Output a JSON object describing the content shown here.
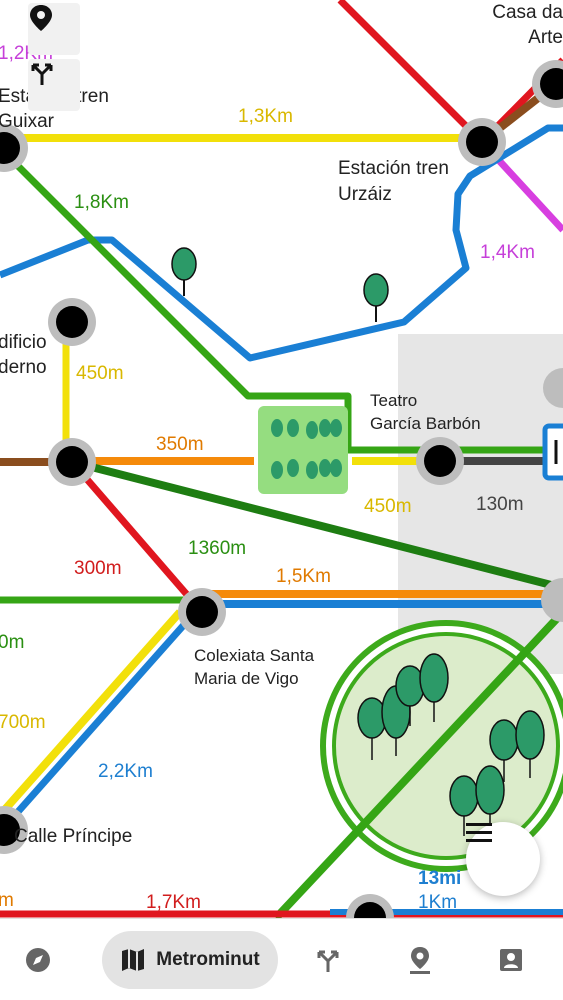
{
  "map": {
    "stations": [
      {
        "name_line1": "Casa da",
        "name_line2": "Arte"
      },
      {
        "name_line1": "Estación tren",
        "name_line2": "Guixar"
      },
      {
        "name_line1": "Estación tren",
        "name_line2": "Urzáiz"
      },
      {
        "name_line1": "dificio",
        "name_line2": "derno"
      },
      {
        "name_line1": "Teatro",
        "name_line2": "García Barbón"
      },
      {
        "name_line1": "Colexiata Santa",
        "name_line2": "Maria de Vigo"
      },
      {
        "name_line1": "Calle Príncipe",
        "name_line2": ""
      }
    ],
    "distances": [
      {
        "text": "1,2Km",
        "color": "#c63fd9"
      },
      {
        "text": "1,3Km",
        "color": "#d9b800"
      },
      {
        "text": "1,8Km",
        "color": "#2a8f12"
      },
      {
        "text": "1,4Km",
        "color": "#c63fd9"
      },
      {
        "text": "450m",
        "color": "#d9b800"
      },
      {
        "text": "350m",
        "color": "#e07a00"
      },
      {
        "text": "450m",
        "color": "#d9b800"
      },
      {
        "text": "130m",
        "color": "#444444"
      },
      {
        "text": "1360m",
        "color": "#2a8f12"
      },
      {
        "text": "300m",
        "color": "#d11d1d"
      },
      {
        "text": "1,5Km",
        "color": "#e07a00"
      },
      {
        "text": "0m",
        "color": "#2a8f12"
      },
      {
        "text": "700m",
        "color": "#d9b800"
      },
      {
        "text": "2,2Km",
        "color": "#1e7fd0"
      },
      {
        "text": "m",
        "color": "#e07a00"
      },
      {
        "text": "1,7Km",
        "color": "#d11d1d"
      },
      {
        "text": "13mi",
        "color": "#1e7fd0"
      },
      {
        "text": "1Km",
        "color": "#1e7fd0"
      }
    ],
    "line_colors": {
      "red": "#e0161f",
      "yellow": "#f2e00a",
      "green": "#35a515",
      "dark_green": "#1e7d12",
      "blue": "#1a7fd4",
      "orange": "#f58a0a",
      "brown": "#8a4d1e",
      "magenta": "#d73fe0",
      "dark_gray": "#444444"
    }
  },
  "controls": {
    "location_icon": "map-pin-icon",
    "routes_icon": "fork-arrows-icon",
    "menu_icon": "hamburger-menu-icon"
  },
  "bottom_nav": {
    "items": [
      {
        "icon": "compass-icon",
        "label": ""
      },
      {
        "icon": "map-icon",
        "label": "Metrominut"
      },
      {
        "icon": "fork-arrows-icon",
        "label": ""
      },
      {
        "icon": "map-pin-icon",
        "label": ""
      },
      {
        "icon": "contact-card-icon",
        "label": ""
      }
    ],
    "active_index": 1
  }
}
